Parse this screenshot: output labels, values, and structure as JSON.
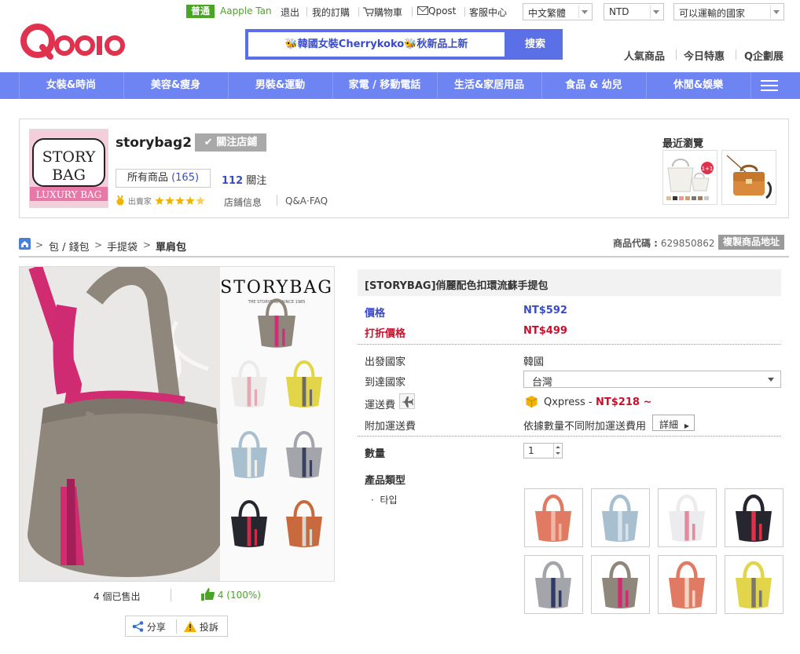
{
  "topbar": {
    "grade": "普通",
    "username": "Aapple Tan",
    "links": [
      "退出",
      "我的訂購",
      "購物車",
      "Qpost",
      "客服中心"
    ],
    "language": "中文繁體",
    "currency": "NTD",
    "ship_to": "可以運輸的國家"
  },
  "header": {
    "logo_text": "Qoo10",
    "search_text": "🐝韓國女裝Cherrykoko🐝秋新品上新",
    "search_button": "搜索",
    "links": [
      "人氣商品",
      "今日特惠",
      "Q企劃展"
    ]
  },
  "categories": [
    "女裝&時尚",
    "美容&瘦身",
    "男裝&運動",
    "家電 / 移動電話",
    "生活&家居用品",
    "食品 & 幼兒",
    "休閒&娛樂"
  ],
  "shop": {
    "logo_lines": [
      "STORY",
      "BAG",
      "LUXURY BAG"
    ],
    "name": "storybag2",
    "follow_button": "✔ 關注店鋪",
    "all_products_label": "所有商品",
    "all_products_count": "(165)",
    "follow_count": "112",
    "follow_label": "關注",
    "badge_text": "出賣家",
    "rating": 4.5,
    "links": [
      "店鋪信息",
      "Q&A·FAQ"
    ],
    "recent_title": "最近瀏覽",
    "recent_badge": "1+1"
  },
  "breadcrumb": {
    "items": [
      "包 / 錢包",
      "手提袋",
      "單肩包"
    ],
    "code_label": "商品代碼 :",
    "code_value": "629850862",
    "copy_button": "複製商品地址"
  },
  "main_image": {
    "brand": "STORYBAG",
    "tagline": "THE STORYBAG / SINCE 1985"
  },
  "stats": {
    "sold": "4 個已售出",
    "likes": "4 (100%)",
    "share": "分享",
    "report": "投訴"
  },
  "product": {
    "title": "[STORYBAG]俏麗配色扣環流蘇手提包",
    "price_label": "價格",
    "price": "NT$592",
    "discount_label": "打折價格",
    "discount_price": "NT$499",
    "origin_label": "出發國家",
    "origin": "韓國",
    "dest_label": "到達國家",
    "dest": "台灣",
    "shipping_label": "運送費",
    "shipping_method": "Qxpress -",
    "shipping_fee": "NT$218 ~",
    "extra_label": "附加運送費",
    "extra_value": "依據數量不同附加運送費用",
    "detail_button": "詳細",
    "qty_label": "數量",
    "qty_value": "1",
    "type_heading": "產品類型",
    "type_name": "타입"
  },
  "colors": {
    "accent": "#6e84f2",
    "search": "#5b6fe6",
    "green": "#4aa526",
    "blue_text": "#3a4bc9",
    "red_text": "#c8102e",
    "bag_taupe": "#8f877c",
    "bag_pink": "#d42a78",
    "bag_coral": "#e07a62",
    "bag_blue": "#a8bfd0",
    "bag_white": "#ecebea",
    "bag_black": "#26262e",
    "bag_grey": "#a3a5aa",
    "bag_yellow": "#e3d54a",
    "bag_orange": "#c96a3e"
  },
  "icons": [
    "cart-icon",
    "mail-icon",
    "home-icon",
    "plane-icon",
    "box-icon",
    "thumbs-up-icon",
    "share-icon",
    "warning-icon",
    "menu-icon"
  ]
}
